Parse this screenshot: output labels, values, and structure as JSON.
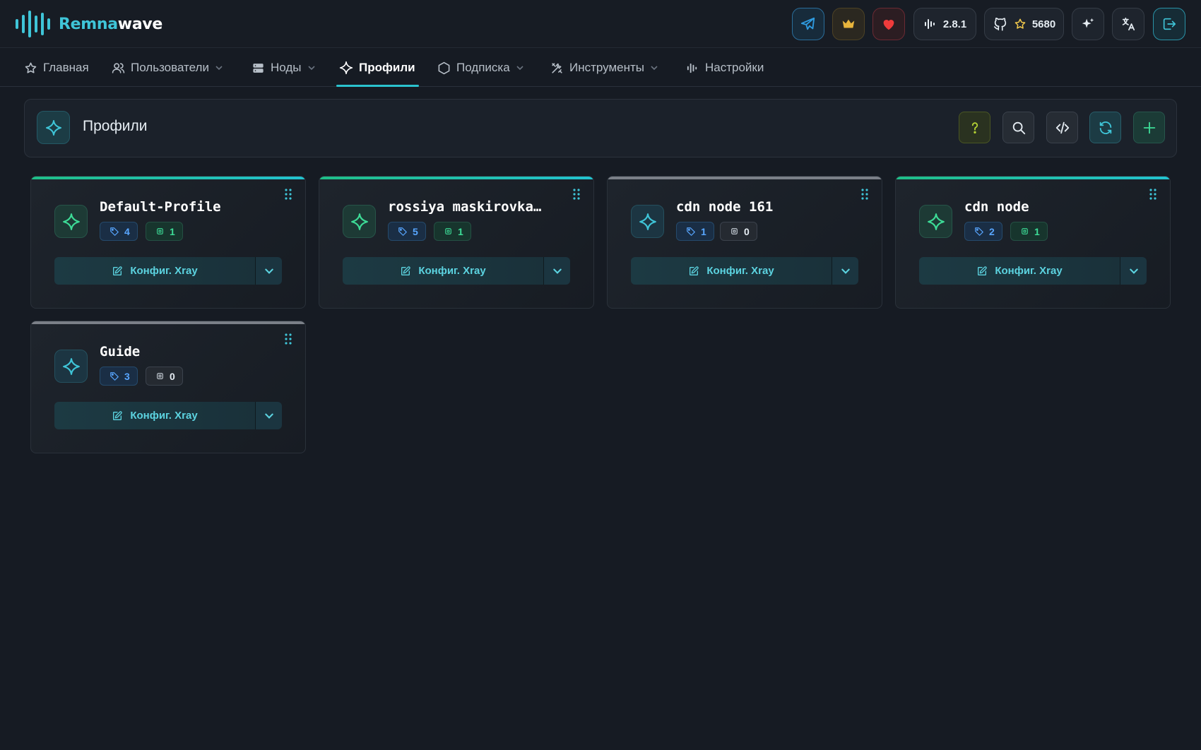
{
  "app": {
    "brand_part1": "Remna",
    "brand_part2": "wave",
    "accent_color": "#2bc3cf"
  },
  "header": {
    "version": "2.8.1",
    "github_stars": "5680",
    "buttons": [
      "telegram-icon",
      "crown-icon",
      "heart-icon",
      "version-icon",
      "github-icon",
      "sparkles-icon",
      "translate-icon",
      "logout-icon"
    ]
  },
  "nav": {
    "items": [
      {
        "label": "Главная",
        "icon": "star-icon",
        "has_dropdown": false
      },
      {
        "label": "Пользователи",
        "icon": "users-icon",
        "has_dropdown": true
      },
      {
        "label": "Ноды",
        "icon": "server-icon",
        "has_dropdown": true
      },
      {
        "label": "Профили",
        "icon": "sparkle-icon",
        "has_dropdown": false,
        "active": true
      },
      {
        "label": "Подписка",
        "icon": "hexagon-icon",
        "has_dropdown": true
      },
      {
        "label": "Инструменты",
        "icon": "tools-icon",
        "has_dropdown": true
      },
      {
        "label": "Настройки",
        "icon": "audio-lines-icon",
        "has_dropdown": false
      }
    ]
  },
  "page": {
    "title": "Профили"
  },
  "profiles": [
    {
      "name": "Default-Profile",
      "inbounds": "4",
      "nodes": "1",
      "active": true,
      "button_label": "Конфиг. Xray"
    },
    {
      "name": "rossiya maskirovka…",
      "inbounds": "5",
      "nodes": "1",
      "active": true,
      "button_label": "Конфиг. Xray"
    },
    {
      "name": "cdn node 161",
      "inbounds": "1",
      "nodes": "0",
      "active": false,
      "button_label": "Конфиг. Xray"
    },
    {
      "name": "cdn node",
      "inbounds": "2",
      "nodes": "1",
      "active": true,
      "button_label": "Конфиг. Xray"
    },
    {
      "name": "Guide",
      "inbounds": "3",
      "nodes": "0",
      "active": false,
      "button_label": "Конфиг. Xray"
    }
  ]
}
